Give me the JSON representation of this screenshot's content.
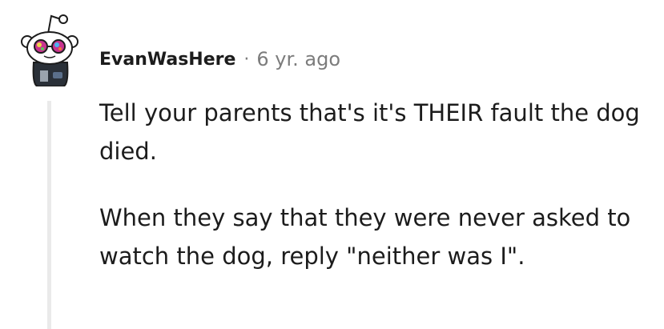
{
  "comment": {
    "username": "EvanWasHere",
    "separator": "·",
    "timestamp": "6 yr. ago",
    "paragraphs": [
      "Tell your parents that's it's THEIR fault the dog died.",
      "When they say that they were never asked to watch the dog, reply \"neither was I\"."
    ]
  },
  "colors": {
    "text": "#1c1c1c",
    "meta": "#7c7c7c",
    "thread_line": "#eaeaea",
    "avatar_body": "#2a3038",
    "avatar_glasses": "#c8348f"
  }
}
